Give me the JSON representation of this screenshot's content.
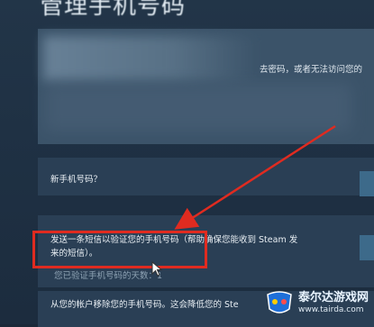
{
  "page": {
    "title": "管理手机号码"
  },
  "info_card": {
    "visible_text": "去密码，或者无法访问您的"
  },
  "sections": {
    "new_phone": {
      "label": "新手机号码？"
    },
    "verify": {
      "line1": "发送一条短信以验证您的手机号码（帮助确保您能收到 Steam 发",
      "line2": "来的短信）。",
      "days_label": "您已验证手机号码的天数：1"
    },
    "remove": {
      "label": "从您的帐户移除您的手机号码。这会降低您的 Ste"
    }
  },
  "watermark": {
    "name": "泰尔达游戏网",
    "url": "www.tairda.com"
  },
  "colors": {
    "background": "#1b2838",
    "card": "#3b5369",
    "section": "#2a3f55",
    "highlight": "#e02b20"
  }
}
